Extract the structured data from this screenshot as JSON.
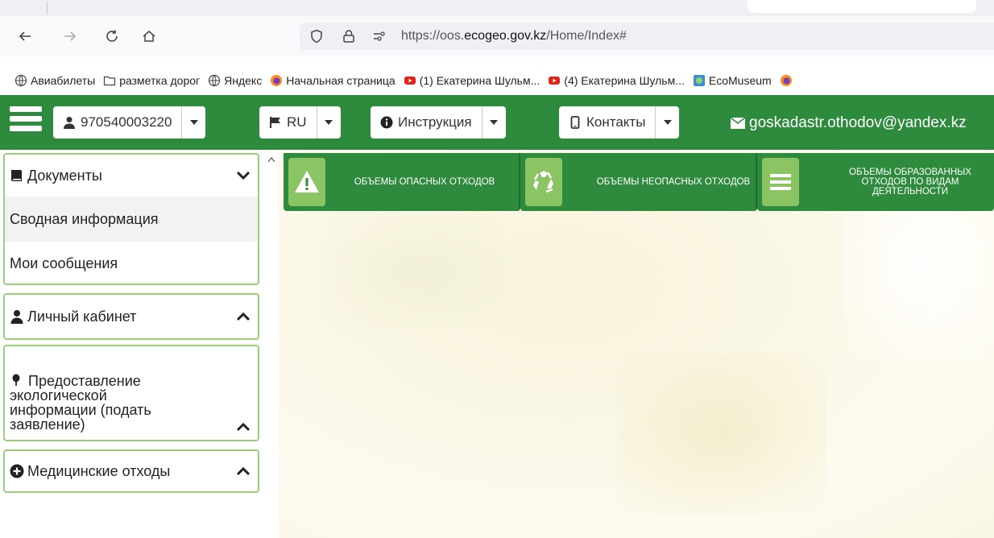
{
  "browser": {
    "url_prefix": "https://oos.",
    "url_domain": "ecogeo.gov.kz",
    "url_path": "/Home/Index#",
    "nav_icons": [
      "back-arrow-icon",
      "forward-arrow-icon",
      "reload-icon",
      "home-icon"
    ],
    "bookmarks": [
      {
        "label": "Авиабилеты",
        "icon": "globe-icon"
      },
      {
        "label": "разметка дорог",
        "icon": "folder-icon"
      },
      {
        "label": "Яндекс",
        "icon": "globe-icon"
      },
      {
        "label": "Начальная страница",
        "icon": "firefox-icon"
      },
      {
        "label": "(1) Екатерина Шульм...",
        "icon": "youtube-icon"
      },
      {
        "label": "(4) Екатерина Шульм...",
        "icon": "youtube-icon"
      },
      {
        "label": "EcoMuseum",
        "icon": "ecomuseum-icon"
      }
    ]
  },
  "header": {
    "account": "970540003220",
    "language": "RU",
    "instructions": "Инструкция",
    "contacts": "Контакты",
    "email": "goskadastr.othodov@yandex.kz"
  },
  "sidebar": {
    "documents": {
      "label": "Документы",
      "items": [
        "Сводная информация",
        "Мои сообщения"
      ]
    },
    "cabinet": {
      "label": "Личный кабинет"
    },
    "eco_info": {
      "label": "Предоставление экологической информации (подать заявление)"
    },
    "medical": {
      "label": "Медицинские отходы"
    }
  },
  "tiles": [
    {
      "label": "Объемы опасных отходов",
      "icon": "warning-icon"
    },
    {
      "label": "Объемы неопасных отходов",
      "icon": "recycle-icon"
    },
    {
      "label": "Объемы образованных отходов по видам деятельности",
      "icon": "list-icon"
    }
  ],
  "colors": {
    "brand_green": "#2e8b3e",
    "tile_icon_green": "#8bc462",
    "panel_border": "#9ccf7d"
  }
}
